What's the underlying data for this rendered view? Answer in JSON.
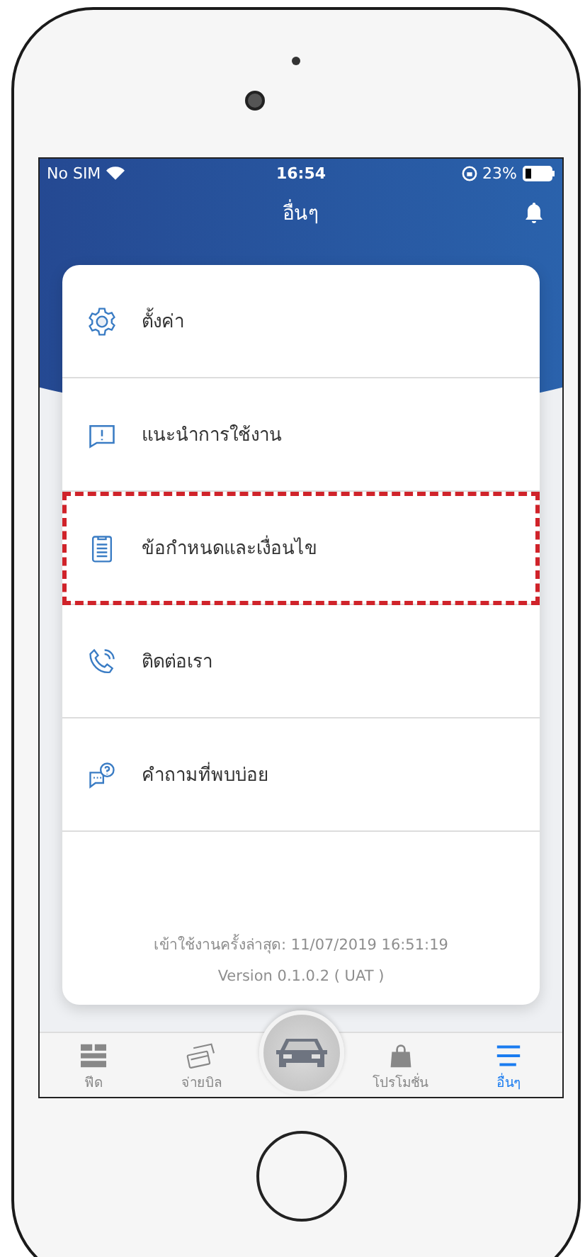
{
  "status_bar": {
    "carrier": "No SIM",
    "time": "16:54",
    "battery": "23%"
  },
  "header": {
    "title": "อื่นๆ"
  },
  "menu": [
    {
      "label": "ตั้งค่า",
      "kind": "settings",
      "highlighted": false
    },
    {
      "label": "แนะนำการใช้งาน",
      "kind": "guide",
      "highlighted": false
    },
    {
      "label": "ข้อกำหนดและเงื่อนไข",
      "kind": "terms",
      "highlighted": true
    },
    {
      "label": "ติดต่อเรา",
      "kind": "contact",
      "highlighted": false
    },
    {
      "label": "คำถามที่พบบ่อย",
      "kind": "faq",
      "highlighted": false
    }
  ],
  "footer": {
    "last_login": "เข้าใช้งานครั้งล่าสุด: 11/07/2019 16:51:19",
    "version": "Version 0.1.0.2 ( UAT )"
  },
  "tabs": [
    {
      "label": "ฟีด",
      "kind": "feed",
      "selected": false
    },
    {
      "label": "จ่ายบิล",
      "kind": "bill",
      "selected": false
    },
    {
      "kind": "car",
      "selected": false
    },
    {
      "label": "โปรโมชั่น",
      "kind": "promo",
      "selected": false
    },
    {
      "label": "อื่นๆ",
      "kind": "more",
      "selected": true
    }
  ]
}
